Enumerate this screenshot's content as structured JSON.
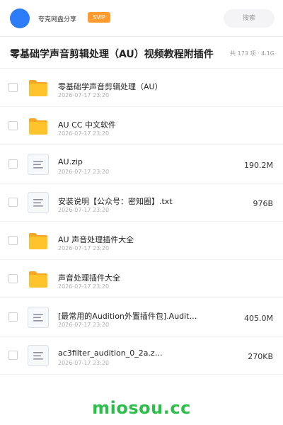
{
  "header": {
    "share_name": "夸克网盘分享",
    "vip_badge": "SVIP",
    "search_placeholder": "搜索"
  },
  "share": {
    "title": "零基础学声音剪辑处理（AU）视频教程附插件",
    "meta": "共 173 项 · 4.1G"
  },
  "files": [
    {
      "type": "folder",
      "name": "零基础学声音剪辑处理（AU）",
      "date": "2026-07-17 23:20",
      "size": ""
    },
    {
      "type": "folder",
      "name": "AU CC 中文软件",
      "date": "2026-07-17 23:20",
      "size": ""
    },
    {
      "type": "file",
      "name": "AU.zip",
      "date": "2026-07-17 23:20",
      "size": "190.2M"
    },
    {
      "type": "file",
      "name": "安装说明【公众号：密知圈】.txt",
      "date": "2026-07-17 23:20",
      "size": "976B"
    },
    {
      "type": "folder",
      "name": "AU 声音处理插件大全",
      "date": "2026-07-17 23:20",
      "size": ""
    },
    {
      "type": "folder",
      "name": "声音处理插件大全",
      "date": "2026-07-17 23:20",
      "size": ""
    },
    {
      "type": "file",
      "name": "[最常用的Audition外置插件包].Audit…",
      "date": "2026-07-17 23:20",
      "size": "405.0M"
    },
    {
      "type": "file",
      "name": "ac3filter_audition_0_2a.z…",
      "date": "2026-07-17 23:20",
      "size": "270KB"
    }
  ],
  "watermark": "miosou.cc",
  "colors": {
    "avatar": "#2b7cf6",
    "vip": "#ff9b2f",
    "folder": "#ffc32b",
    "watermark": "#2bbf49"
  },
  "icons": {
    "folder": "folder-icon",
    "file": "document-icon"
  }
}
